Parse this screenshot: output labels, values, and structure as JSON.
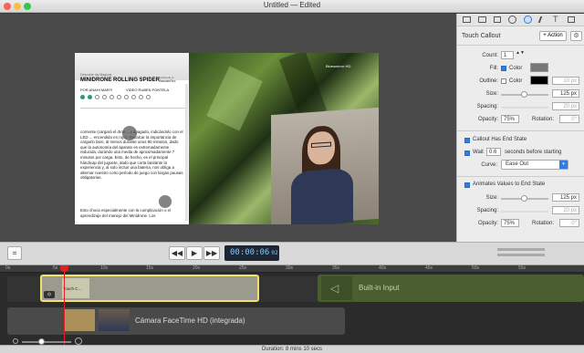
{
  "window": {
    "title": "Untitled — Edited"
  },
  "doc": {
    "header_small": "Descubre las Magicas",
    "heading": "MINIDRONE ROLLING SPIDER",
    "sub1": "Publicado el",
    "sub2": "JazmanRex",
    "author": "POR ANAHI MARTI",
    "video": "VIDEO RUBEN FONTELA",
    "body": "corriente (cargará el dron... o apagado, indicándolo con el LED ... encendido en rojo). Recalcar la importancia de cargarlo bien, al menos durante unos 90 minutos, dado que la autonomía del aparato es extremadamente reducida, durando una media de aproximadamente 7 minutos por carga. Esto, de hecho, es el principal hándicap del juguete, dado que corta bastante la experiencia y, al solo incluir una batería, nos obliga a alternar nuestro corto periodo de juego con largas pausas obligatorias.",
    "body2": "Esto choca especialmente con la complicación o el aprendizaje del manejo del Minidrone. Los"
  },
  "video_badge": "Bluesmirror HD",
  "inspector": {
    "title": "Touch Callout",
    "action_label": "+ Action",
    "count_label": "Count:",
    "count_value": "1",
    "fill_label": "Fill:",
    "fill_color_label": "Color",
    "outline_label": "Outline:",
    "outline_color_label": "Color",
    "outline_value": "10 px",
    "size_label": "Size:",
    "size_value": "125 px",
    "spacing_label": "Spacing:",
    "spacing_value": "20 px",
    "opacity_label": "Opacity:",
    "opacity_value": "75%",
    "rotation_label": "Rotation:",
    "rotation_value": "0°",
    "has_end_state_label": "Callout Has End State",
    "wait_label": "Wait",
    "wait_value": "0.6",
    "wait_suffix": "seconds before starting",
    "curve_label": "Curve:",
    "curve_value": "Ease Out",
    "animates_label": "Animates Values to End State",
    "size2_value": "125 px",
    "spacing2_value": "20 px",
    "opacity2_value": "75%",
    "rotation2_value": "0°",
    "accent": "#2f7de1"
  },
  "transport": {
    "timecode_main": "00:00:06",
    "timecode_frames": "02"
  },
  "timeline": {
    "ruler": [
      "0s",
      "5s",
      "10s",
      "15s",
      "20s",
      "25s",
      "30s",
      "35s",
      "40s",
      "45s",
      "50s",
      "55s"
    ],
    "clip1_label": "Touch C...",
    "clip2_label": "Built-in Input",
    "clip3_label": "Cámara FaceTime HD (integrada)",
    "playhead_color": "#e02020"
  },
  "status": {
    "duration": "Duration: 8 mins 10 secs"
  }
}
